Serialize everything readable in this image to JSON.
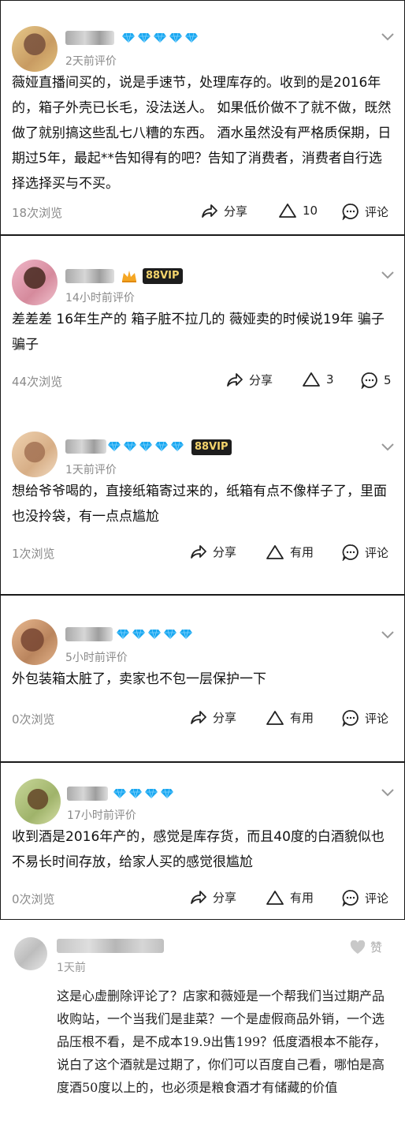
{
  "reviews": [
    {
      "time": "2天前评价",
      "text": "薇娅直播间买的，说是手速节，处理库存的。收到的是2016年的，箱子外壳已长毛，没法送人。 如果低价做不了就不做，既然做了就别搞这些乱七八糟的东西。 酒水虽然没有严格质保期，日期过5年，最起**告知得有的吧？告知了消费者，消费者自行选择选择买与不买。",
      "views": "18次浏览",
      "share": "分享",
      "like": "10",
      "comment": "评论"
    },
    {
      "time": "14小时前评价",
      "vip": "88VIP",
      "text": "差差差 16年生产的 箱子脏不拉几的  薇娅卖的时候说19年 骗子 骗子",
      "views": "44次浏览",
      "share": "分享",
      "like": "3",
      "comment": "5"
    },
    {
      "time": "1天前评价",
      "vip": "88VIP",
      "text": "想给爷爷喝的，直接纸箱寄过来的，纸箱有点不像样子了，里面也没拎袋，有一点点尴尬",
      "views": "1次浏览",
      "share": "分享",
      "like": "有用",
      "comment": "评论"
    },
    {
      "time": "5小时前评价",
      "text": "外包装箱太脏了，卖家也不包一层保护一下",
      "views": "0次浏览",
      "share": "分享",
      "like": "有用",
      "comment": "评论"
    },
    {
      "time": "17小时前评价",
      "text": "收到酒是2016年产的，感觉是库存货，而且40度的白酒貌似也不易长时间存放，给家人买的感觉很尴尬",
      "views": "0次浏览",
      "share": "分享",
      "like": "有用",
      "comment": "评论"
    }
  ],
  "last_comment": {
    "time": "1天前",
    "like": "赞",
    "text": "这是心虚删除评论了？店家和薇娅是一个帮我们当过期产品收购站，一个当我们是韭菜？一个是虚假商品外销，一个选品压根不看，是不成本19.9出售199？低度酒根本不能存，说白了这个酒就是过期了，你们可以百度自己看，哪怕是高度酒50度以上的，也必须是粮食酒才有储藏的价值"
  },
  "colors": {
    "diamond": "#1aa7f0",
    "vip_bg": "#1d1d1d",
    "vip_text": "#f3d36b",
    "muted": "#8a8a8a"
  },
  "icons": [
    "share-icon",
    "like-triangle-icon",
    "comment-icon",
    "chevron-down-icon",
    "diamond-icon",
    "crown-icon",
    "heart-icon"
  ]
}
